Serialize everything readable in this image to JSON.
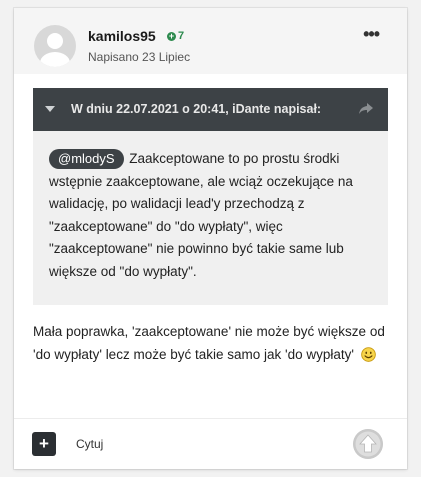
{
  "post": {
    "author": "kamilos95",
    "reputation": "7",
    "date": "Napisano 23 Lipiec",
    "menu_label": "•••"
  },
  "quote": {
    "header": "W dniu 22.07.2021 o 20:41, iDante napisał:",
    "mention": "@mlodyS",
    "text": " Zaakceptowane to po prostu środki wstępnie zaakceptowane, ale wciąż oczekujące na walidację, po walidacji lead'y przechodzą z \"zaakceptowane\" do \"do wypłaty\", więc \"zaakceptowane\" nie powinno być takie same lub większe od \"do wypłaty\"."
  },
  "body": {
    "text": "Mała poprawka, 'zaakceptowane' nie może być większe od 'do wypłaty' lecz może być takie samo jak 'do wypłaty'"
  },
  "actions": {
    "add_label": "+",
    "quote_label": "Cytuj"
  },
  "icons": {
    "expand": "chevron-down-icon",
    "share": "share-arrow-icon",
    "smiley": "smiley-icon",
    "upvote": "upvote-arrow-icon"
  },
  "colors": {
    "quote_header_bg": "#3d4246",
    "reputation_green": "#2d8a4e",
    "quote_body_bg": "#f0f0f0"
  }
}
